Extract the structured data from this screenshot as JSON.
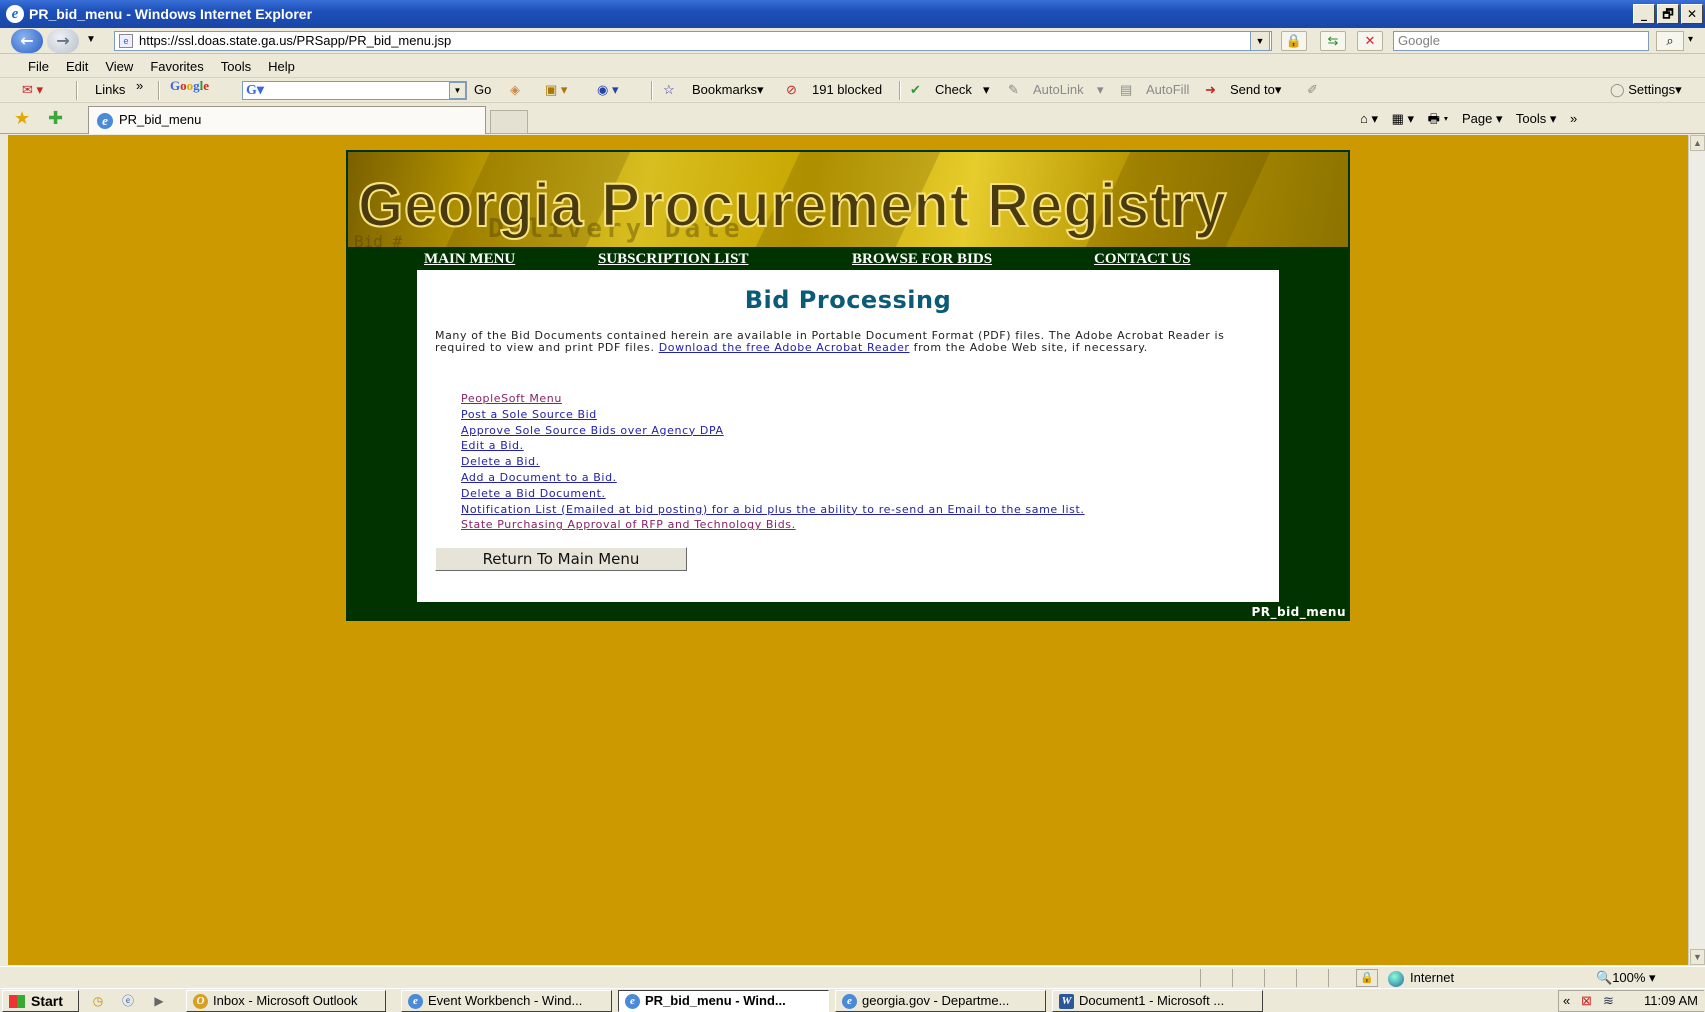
{
  "window": {
    "title": "PR_bid_menu - Windows Internet Explorer",
    "buttons": [
      "_",
      "🗗",
      "✕"
    ]
  },
  "address_bar": {
    "url": "https://ssl.doas.state.ga.us/PRSapp/PR_bid_menu.jsp",
    "search_placeholder": "Google"
  },
  "menu_bar": [
    "File",
    "Edit",
    "View",
    "Favorites",
    "Tools",
    "Help"
  ],
  "toolbar": {
    "links_label": "Links",
    "links_chevron": "»",
    "google_input": "G▾",
    "go_label": "Go",
    "bookmarks_label": "Bookmarks▾",
    "blocked_label": "191 blocked",
    "check_label": "Check",
    "autolink_label": "AutoLink",
    "autofill_label": "AutoFill",
    "sendto_label": "Send to▾",
    "settings_label": "Settings▾"
  },
  "tab_bar": {
    "active_tab_title": "PR_bid_menu",
    "command_bar": [
      "⌂ ▾",
      "▦ ▾",
      "🖶 ▾",
      "Page ▾",
      "Tools ▾"
    ],
    "overflow": "»"
  },
  "page": {
    "banner_title": "Georgia Procurement Registry",
    "nav_links": [
      "MAIN MENU",
      "SUBSCRIPTION LIST",
      "BROWSE FOR BIDS",
      "CONTACT US"
    ],
    "heading": "Bid Processing",
    "intro_text_before": "Many of the Bid Documents contained herein are available in Portable Document Format (PDF) files. The Adobe Acrobat Reader is required to view and print PDF files. ",
    "intro_link": "Download the free Adobe Acrobat Reader",
    "intro_text_after": " from the Adobe Web site, if necessary.",
    "links": [
      "PeopleSoft Menu",
      "Post a Sole Source Bid",
      "Approve Sole Source Bids over Agency DPA",
      "Edit a Bid.",
      "Delete a Bid.",
      "Add a Document to a Bid.",
      "Delete a Bid Document.",
      "Notification List (Emailed at bid posting) for a bid plus the ability to re-send an Email to the same list.",
      "State Purchasing Approval of RFP and Technology Bids."
    ],
    "return_button": "Return To Main Menu",
    "page_id": "PR_bid_menu",
    "background_color": "#cc9900",
    "frame_color": "#003300",
    "heading_color": "#0b5a78"
  },
  "status_bar": {
    "zone": "Internet",
    "zoom": "100%"
  },
  "taskbar": {
    "start_label": "Start",
    "tasks": [
      "Inbox - Microsoft Outlook",
      "Event Workbench - Wind...",
      "PR_bid_menu - Wind...",
      "georgia.gov - Departme...",
      "Document1 - Microsoft ..."
    ],
    "clock": "11:09 AM",
    "tray_expand": "«"
  }
}
